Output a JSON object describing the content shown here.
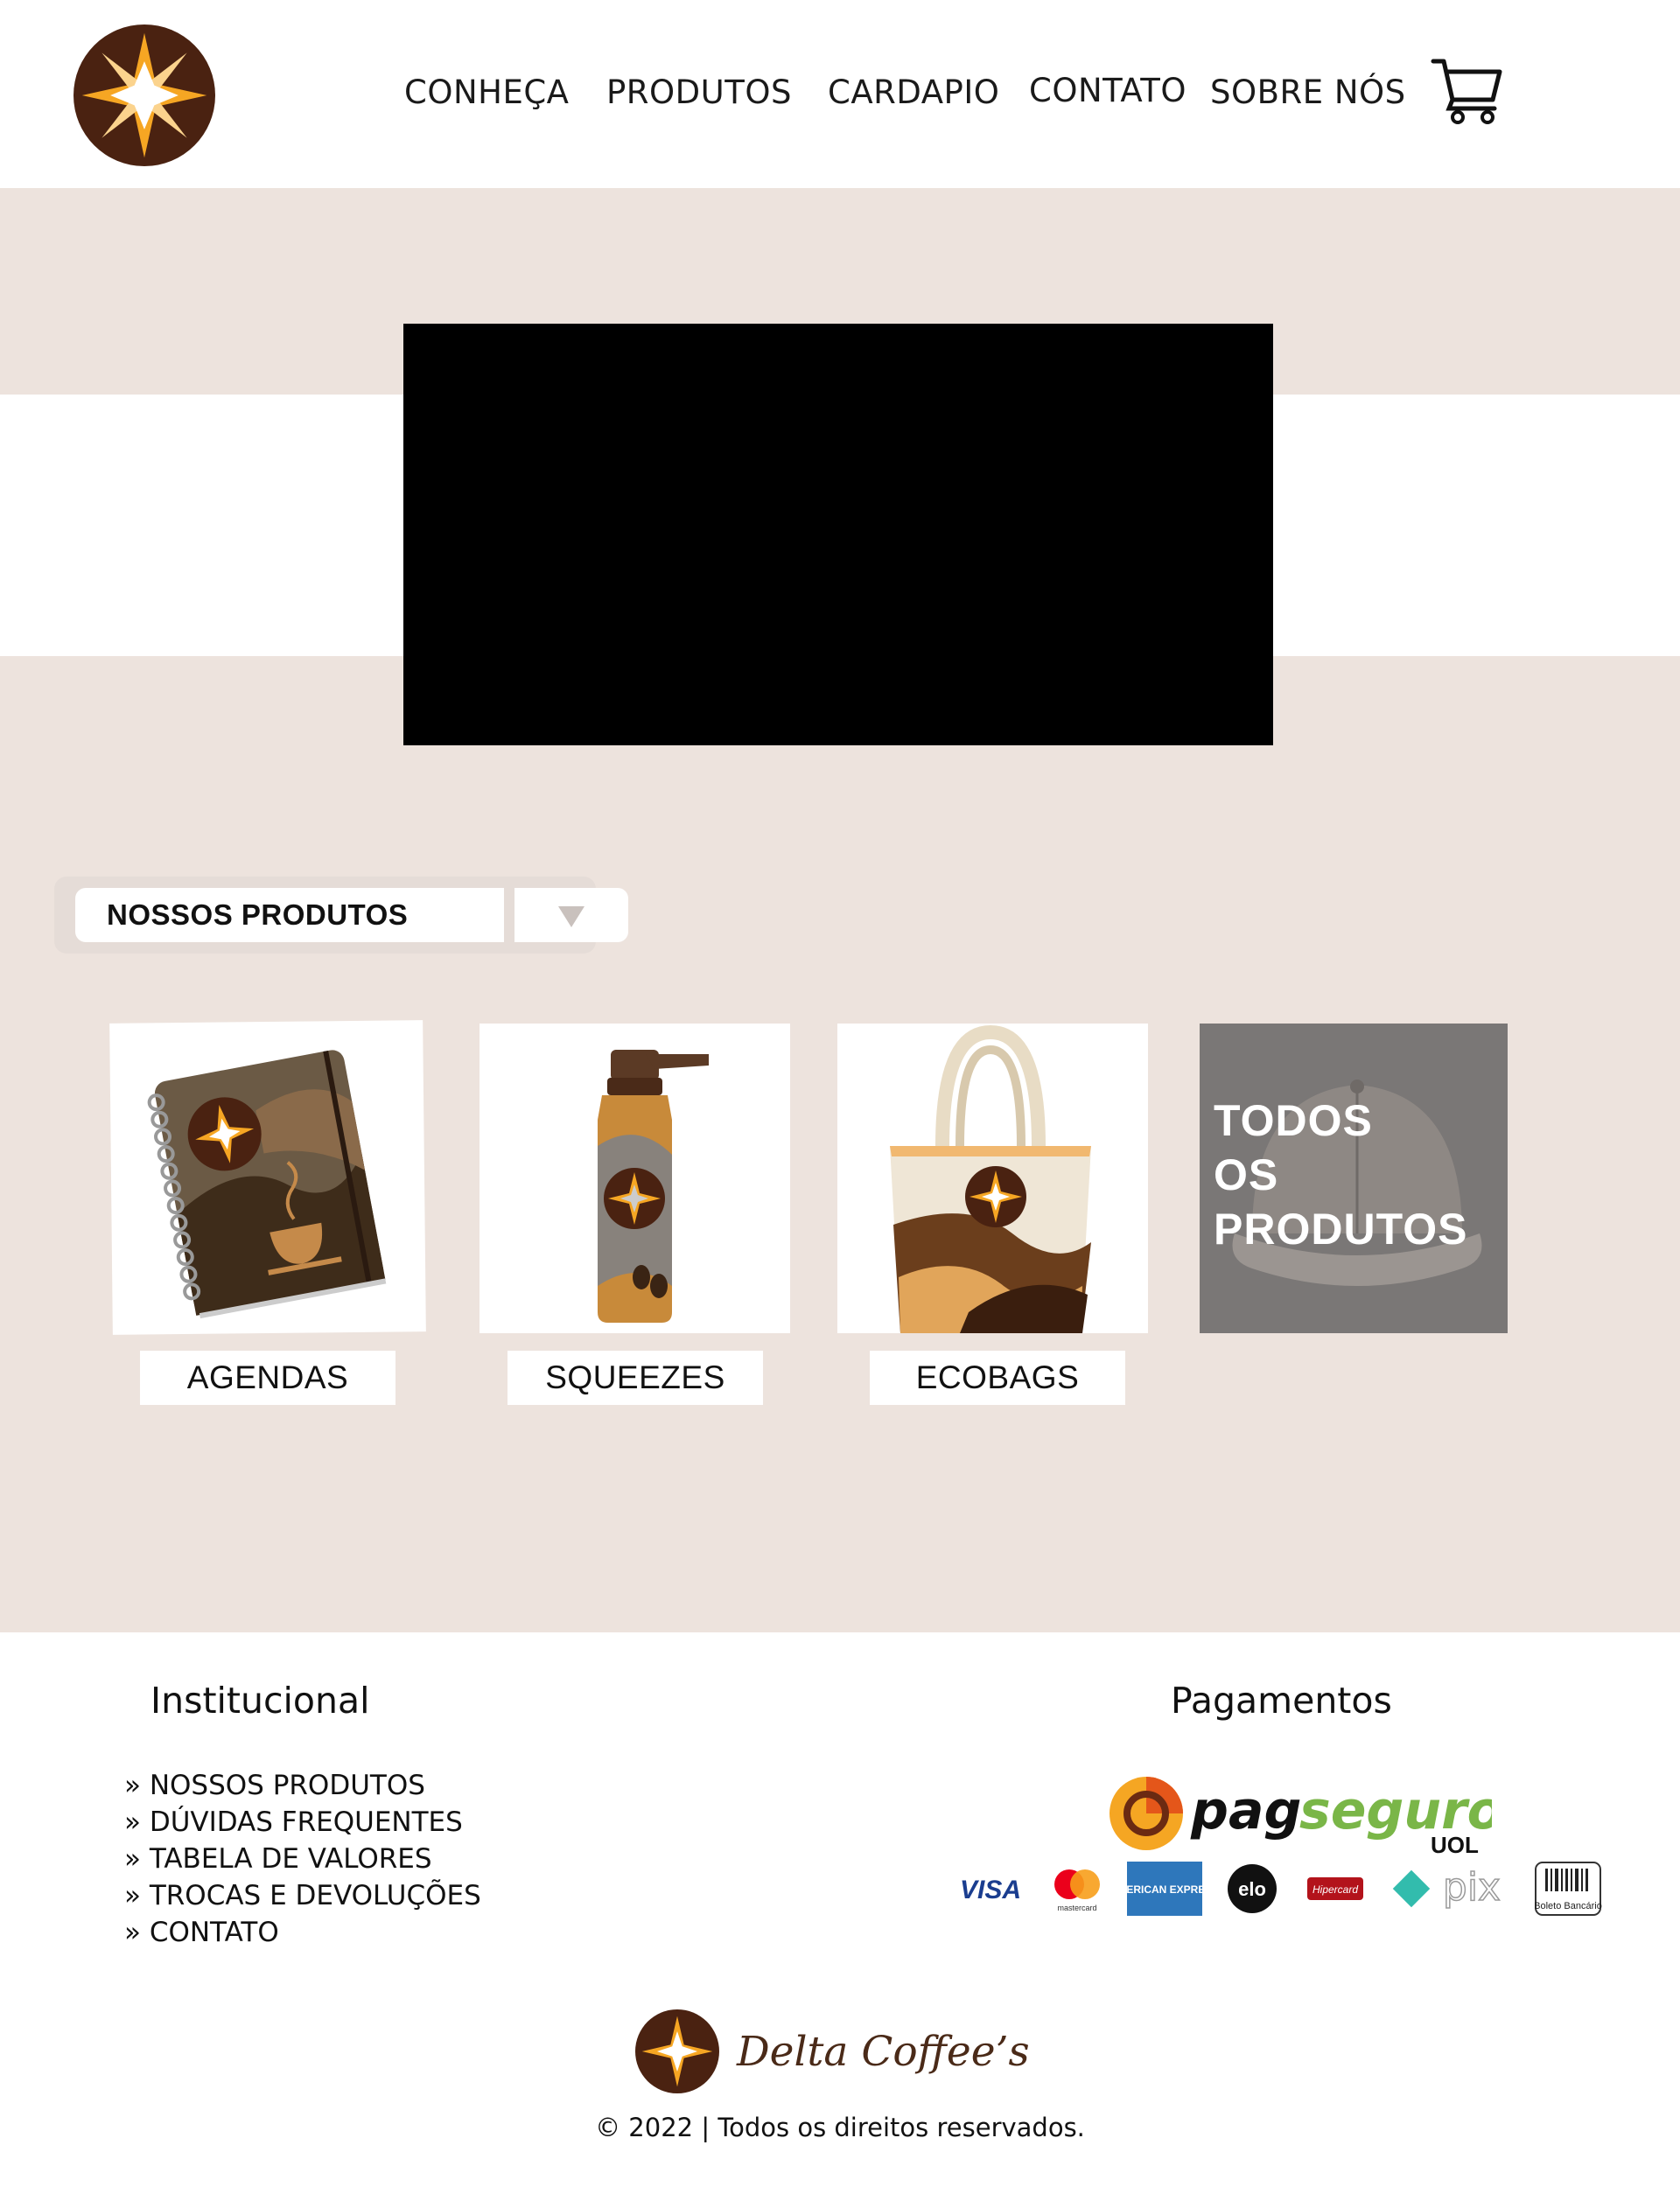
{
  "header": {
    "nav": [
      "CONHEÇA",
      "PRODUTOS",
      "CARDAPIO",
      "CONTATO",
      "SOBRE NÓS"
    ],
    "logo_icon": "compass-star-logo",
    "cart_icon": "cart-icon"
  },
  "colors": {
    "brand_brown": "#4a2211",
    "brand_orange": "#f5a623",
    "background_beige": "#ede3dd",
    "grey_overlay": "#7a7776"
  },
  "hero": {
    "video": "black-video-placeholder"
  },
  "products": {
    "dropdown_label": "NOSSOS PRODUTOS",
    "items": [
      {
        "label": "AGENDAS",
        "icon": "notebook-image"
      },
      {
        "label": "SQUEEZES",
        "icon": "bottle-image"
      },
      {
        "label": "ECOBAGS",
        "icon": "tote-bag-image"
      }
    ],
    "all_products": "TODOS\nOS\nPRODUTOS"
  },
  "footer": {
    "institucional_title": "Institucional",
    "links": [
      "» NOSSOS PRODUTOS",
      "» DÚVIDAS FREQUENTES",
      "» TABELA DE VALORES",
      "» TROCAS E DEVOLUÇÕES",
      "» CONTATO"
    ],
    "pagamentos_title": "Pagamentos",
    "pagseguro": {
      "pag": "pag",
      "seguro": "seguro",
      "uol": "UOL"
    },
    "payment_methods": [
      "VISA",
      "mastercard",
      "AMERICAN EXPRESS",
      "elo",
      "Hipercard",
      "pix",
      "Boleto Bancário"
    ],
    "brand_name": "Delta Coffee’s",
    "copyright": "© 2022 | Todos os direitos reservados."
  }
}
